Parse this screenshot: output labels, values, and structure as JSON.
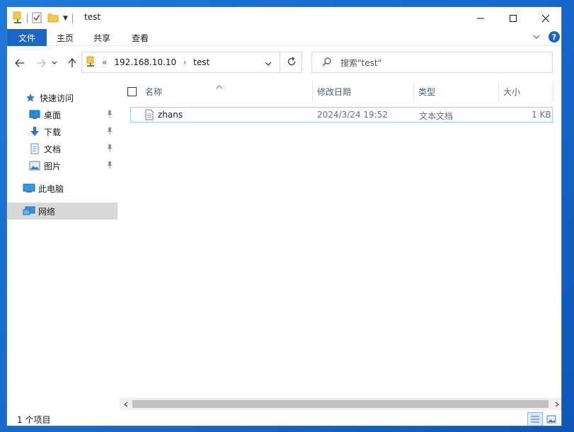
{
  "window": {
    "title": "test",
    "controls": {
      "minimize": "—",
      "maximize": "☐",
      "close": "✕"
    }
  },
  "ribbon": {
    "tabs": [
      "文件",
      "主页",
      "共享",
      "查看"
    ],
    "help": "?"
  },
  "address": {
    "overflow": "«",
    "crumbs": [
      "192.168.10.10",
      "test"
    ]
  },
  "search": {
    "placeholder": "搜索\"test\""
  },
  "sidebar": {
    "quick_access": "快速访问",
    "items": [
      {
        "label": "桌面",
        "icon": "desktop-icon"
      },
      {
        "label": "下载",
        "icon": "download-icon"
      },
      {
        "label": "文档",
        "icon": "document-icon"
      },
      {
        "label": "图片",
        "icon": "pictures-icon"
      }
    ],
    "this_pc": "此电脑",
    "network": "网络"
  },
  "columns": {
    "name": "名称",
    "modified": "修改日期",
    "type": "类型",
    "size": "大小"
  },
  "files": [
    {
      "name": "zhans",
      "modified": "2024/3/24 19:52",
      "type": "文本文档",
      "size": "1 KB"
    }
  ],
  "status": {
    "count": "1 个项目"
  },
  "colors": {
    "accent": "#1a66c8",
    "selected_row_border": "#99d1ff",
    "desktop_bg": "#1565c8"
  }
}
